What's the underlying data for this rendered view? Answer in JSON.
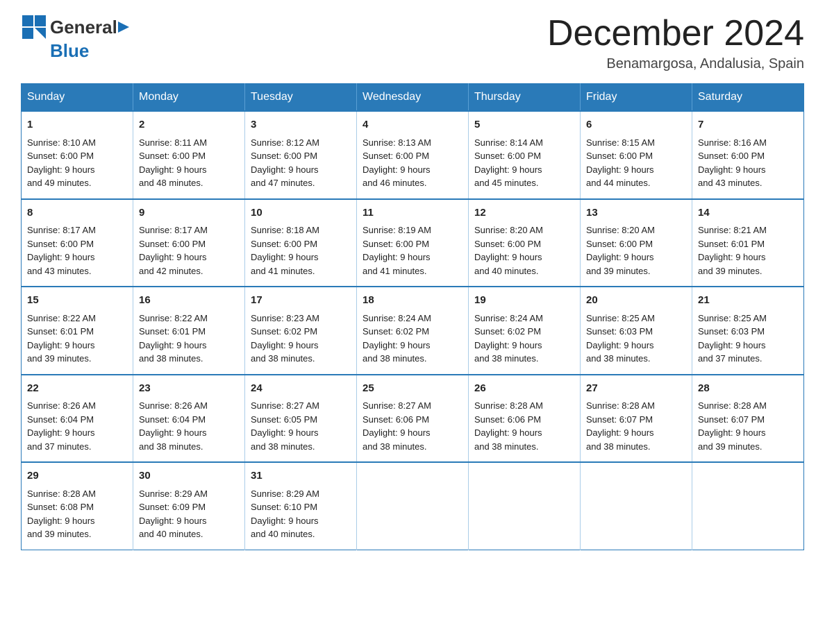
{
  "header": {
    "logo_general": "General",
    "logo_blue": "Blue",
    "month_title": "December 2024",
    "location": "Benamargosa, Andalusia, Spain"
  },
  "days_of_week": [
    "Sunday",
    "Monday",
    "Tuesday",
    "Wednesday",
    "Thursday",
    "Friday",
    "Saturday"
  ],
  "weeks": [
    [
      {
        "num": "1",
        "sunrise": "8:10 AM",
        "sunset": "6:00 PM",
        "daylight": "9 hours and 49 minutes."
      },
      {
        "num": "2",
        "sunrise": "8:11 AM",
        "sunset": "6:00 PM",
        "daylight": "9 hours and 48 minutes."
      },
      {
        "num": "3",
        "sunrise": "8:12 AM",
        "sunset": "6:00 PM",
        "daylight": "9 hours and 47 minutes."
      },
      {
        "num": "4",
        "sunrise": "8:13 AM",
        "sunset": "6:00 PM",
        "daylight": "9 hours and 46 minutes."
      },
      {
        "num": "5",
        "sunrise": "8:14 AM",
        "sunset": "6:00 PM",
        "daylight": "9 hours and 45 minutes."
      },
      {
        "num": "6",
        "sunrise": "8:15 AM",
        "sunset": "6:00 PM",
        "daylight": "9 hours and 44 minutes."
      },
      {
        "num": "7",
        "sunrise": "8:16 AM",
        "sunset": "6:00 PM",
        "daylight": "9 hours and 43 minutes."
      }
    ],
    [
      {
        "num": "8",
        "sunrise": "8:17 AM",
        "sunset": "6:00 PM",
        "daylight": "9 hours and 43 minutes."
      },
      {
        "num": "9",
        "sunrise": "8:17 AM",
        "sunset": "6:00 PM",
        "daylight": "9 hours and 42 minutes."
      },
      {
        "num": "10",
        "sunrise": "8:18 AM",
        "sunset": "6:00 PM",
        "daylight": "9 hours and 41 minutes."
      },
      {
        "num": "11",
        "sunrise": "8:19 AM",
        "sunset": "6:00 PM",
        "daylight": "9 hours and 41 minutes."
      },
      {
        "num": "12",
        "sunrise": "8:20 AM",
        "sunset": "6:00 PM",
        "daylight": "9 hours and 40 minutes."
      },
      {
        "num": "13",
        "sunrise": "8:20 AM",
        "sunset": "6:00 PM",
        "daylight": "9 hours and 39 minutes."
      },
      {
        "num": "14",
        "sunrise": "8:21 AM",
        "sunset": "6:01 PM",
        "daylight": "9 hours and 39 minutes."
      }
    ],
    [
      {
        "num": "15",
        "sunrise": "8:22 AM",
        "sunset": "6:01 PM",
        "daylight": "9 hours and 39 minutes."
      },
      {
        "num": "16",
        "sunrise": "8:22 AM",
        "sunset": "6:01 PM",
        "daylight": "9 hours and 38 minutes."
      },
      {
        "num": "17",
        "sunrise": "8:23 AM",
        "sunset": "6:02 PM",
        "daylight": "9 hours and 38 minutes."
      },
      {
        "num": "18",
        "sunrise": "8:24 AM",
        "sunset": "6:02 PM",
        "daylight": "9 hours and 38 minutes."
      },
      {
        "num": "19",
        "sunrise": "8:24 AM",
        "sunset": "6:02 PM",
        "daylight": "9 hours and 38 minutes."
      },
      {
        "num": "20",
        "sunrise": "8:25 AM",
        "sunset": "6:03 PM",
        "daylight": "9 hours and 38 minutes."
      },
      {
        "num": "21",
        "sunrise": "8:25 AM",
        "sunset": "6:03 PM",
        "daylight": "9 hours and 37 minutes."
      }
    ],
    [
      {
        "num": "22",
        "sunrise": "8:26 AM",
        "sunset": "6:04 PM",
        "daylight": "9 hours and 37 minutes."
      },
      {
        "num": "23",
        "sunrise": "8:26 AM",
        "sunset": "6:04 PM",
        "daylight": "9 hours and 38 minutes."
      },
      {
        "num": "24",
        "sunrise": "8:27 AM",
        "sunset": "6:05 PM",
        "daylight": "9 hours and 38 minutes."
      },
      {
        "num": "25",
        "sunrise": "8:27 AM",
        "sunset": "6:06 PM",
        "daylight": "9 hours and 38 minutes."
      },
      {
        "num": "26",
        "sunrise": "8:28 AM",
        "sunset": "6:06 PM",
        "daylight": "9 hours and 38 minutes."
      },
      {
        "num": "27",
        "sunrise": "8:28 AM",
        "sunset": "6:07 PM",
        "daylight": "9 hours and 38 minutes."
      },
      {
        "num": "28",
        "sunrise": "8:28 AM",
        "sunset": "6:07 PM",
        "daylight": "9 hours and 39 minutes."
      }
    ],
    [
      {
        "num": "29",
        "sunrise": "8:28 AM",
        "sunset": "6:08 PM",
        "daylight": "9 hours and 39 minutes."
      },
      {
        "num": "30",
        "sunrise": "8:29 AM",
        "sunset": "6:09 PM",
        "daylight": "9 hours and 40 minutes."
      },
      {
        "num": "31",
        "sunrise": "8:29 AM",
        "sunset": "6:10 PM",
        "daylight": "9 hours and 40 minutes."
      },
      null,
      null,
      null,
      null
    ]
  ]
}
